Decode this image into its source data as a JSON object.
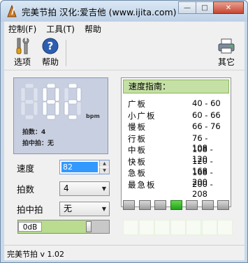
{
  "window": {
    "title": "完美节拍 汉化:爱吉他 (www.ijita.com)",
    "buttons": {
      "minimize": "—",
      "maximize": "□",
      "close": "✕"
    }
  },
  "menu": [
    "控制(F)",
    "工具(T)",
    "帮助"
  ],
  "toolbar": {
    "options_label": "选项",
    "help_label": "帮助",
    "other_label": "其它"
  },
  "display": {
    "digits": "82",
    "unit": "bpm",
    "beats_label": "拍数：4",
    "subdivision_label": "拍中拍：无"
  },
  "guide": {
    "title": "速度指南：",
    "rows": [
      {
        "name": "广板",
        "range": "40 - 60"
      },
      {
        "name": "小广板",
        "range": "60 - 66"
      },
      {
        "name": "慢板",
        "range": "66 - 76"
      },
      {
        "name": "行板",
        "range": "76 - 108"
      },
      {
        "name": "中板",
        "range": "108 - 120"
      },
      {
        "name": "快板",
        "range": "120 - 168"
      },
      {
        "name": "急板",
        "range": "168 - 200"
      },
      {
        "name": "最急板",
        "range": "200 - 208"
      }
    ]
  },
  "controls": {
    "speed_label": "速度",
    "speed_value": "82",
    "beats_label": "拍数",
    "beats_value": "4",
    "subdivision_label": "拍中拍",
    "subdivision_value": "无"
  },
  "volume": {
    "label": "0dB",
    "level": 0.78
  },
  "beat_lights": {
    "count": 7,
    "active_index": 3
  },
  "status": {
    "text": "完美节拍 v 1.02"
  },
  "colors": {
    "accent_green": "#c5e0a5",
    "active_beat": "#3dbb2b",
    "display_bg": "#c8cfe0"
  }
}
